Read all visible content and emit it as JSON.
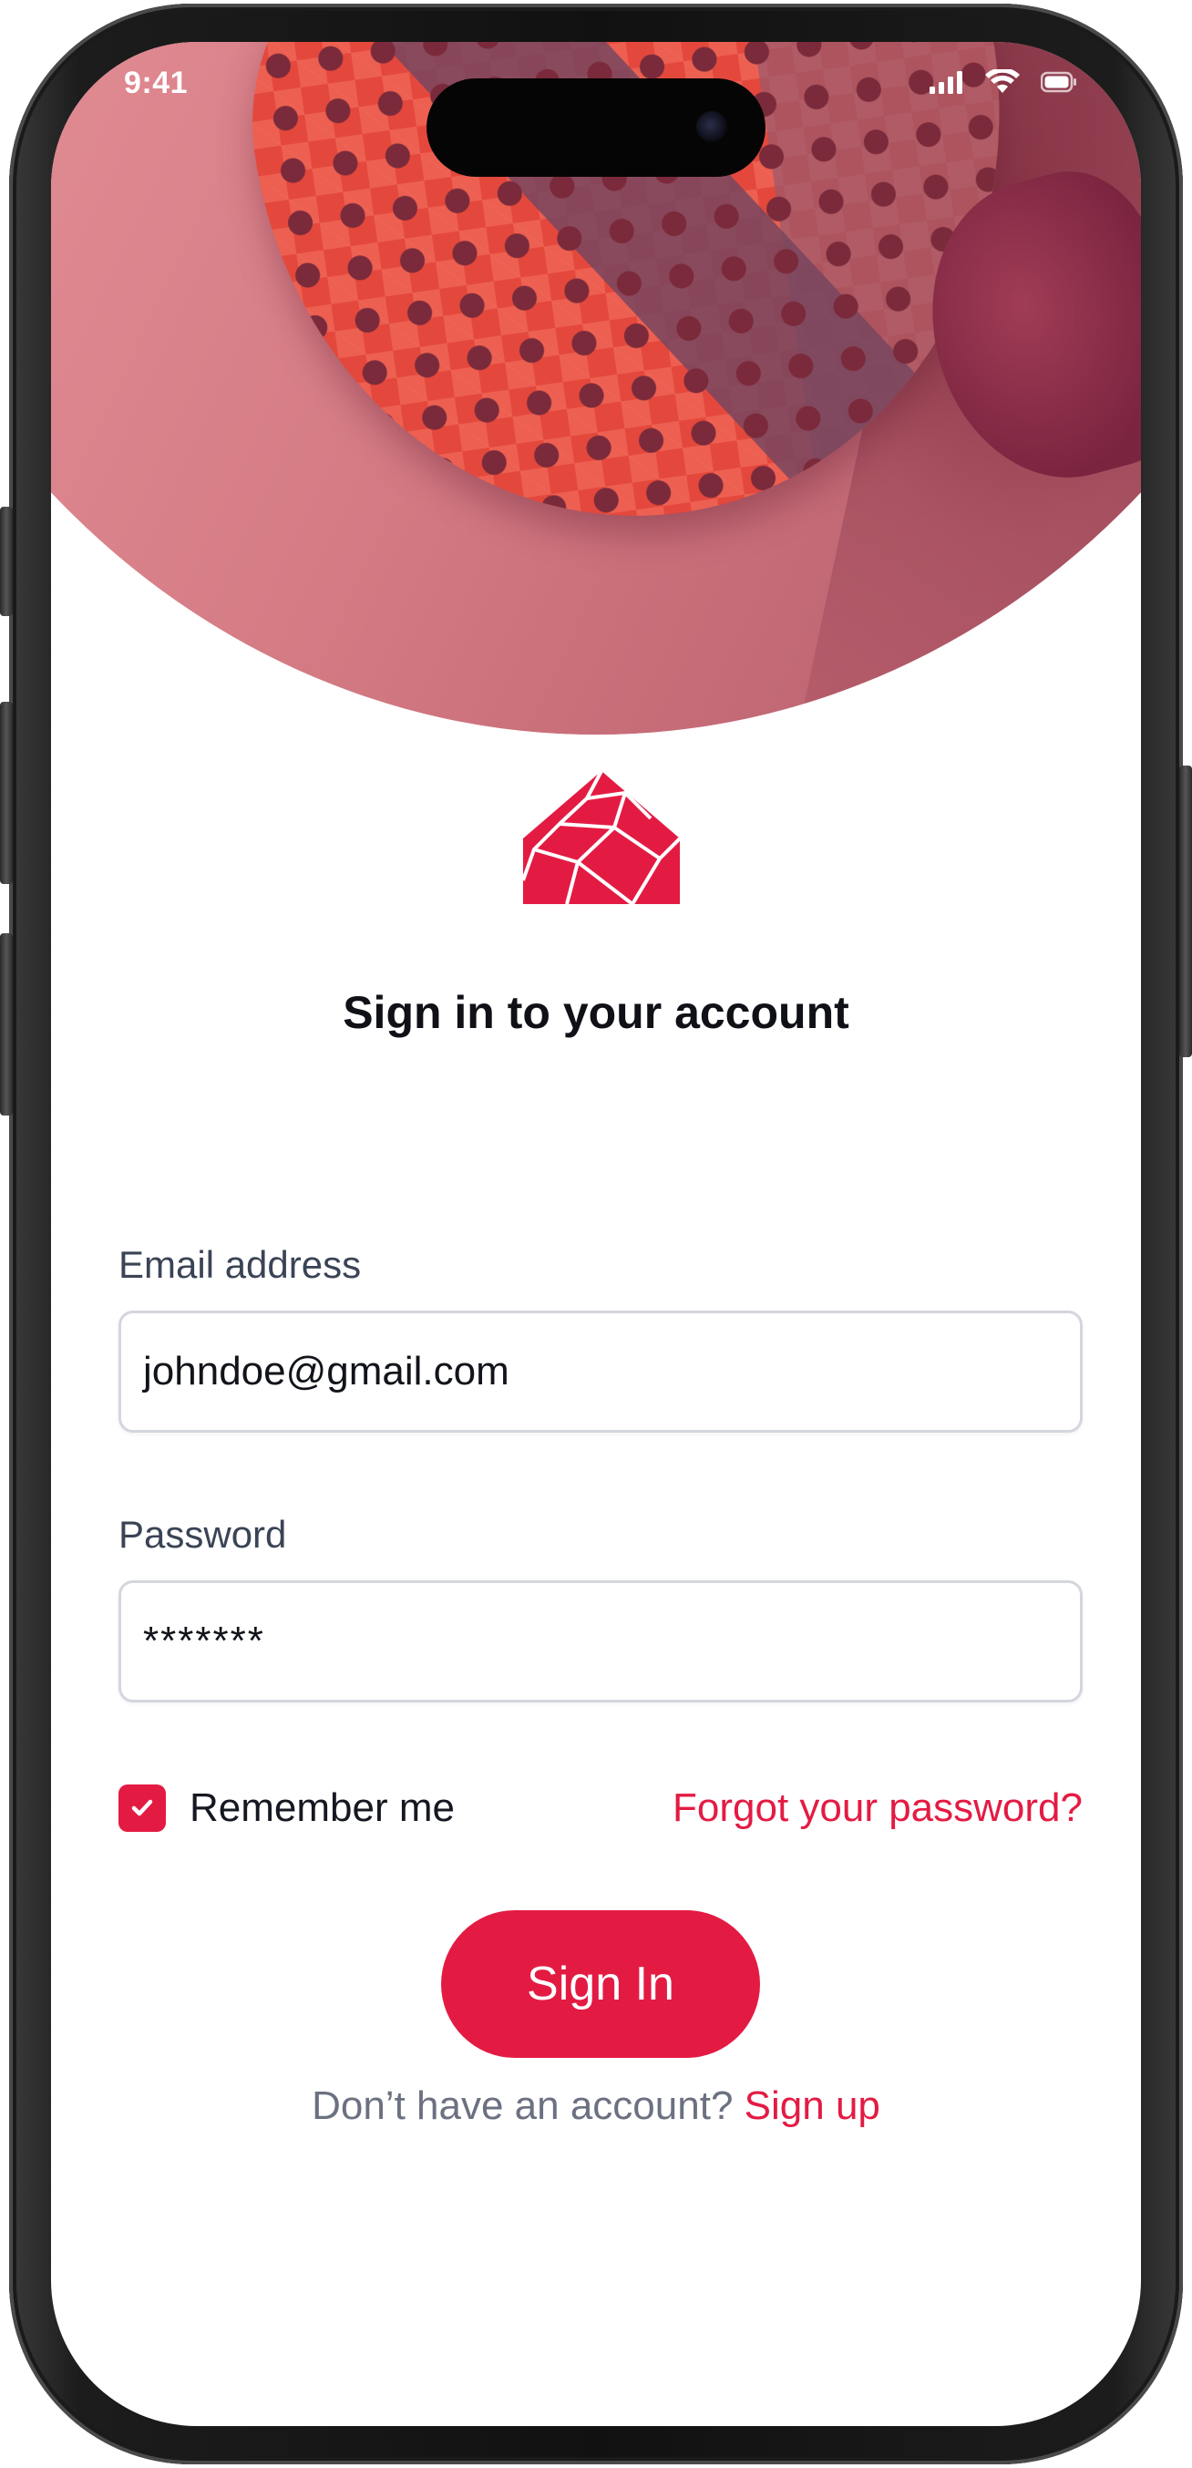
{
  "status_bar": {
    "time": "9:41",
    "icons": [
      "cellular-signal-icon",
      "wifi-icon",
      "battery-icon"
    ]
  },
  "hero": {
    "image": "padel-racket-photo"
  },
  "logo": {
    "icon": "faceted-house-logo"
  },
  "login": {
    "title": "Sign in to your account",
    "email_label": "Email address",
    "email_value": "johndoe@gmail.com",
    "password_label": "Password",
    "password_value": "*******",
    "remember_label": "Remember me",
    "remember_checked": true,
    "forgot_label": "Forgot your password?",
    "signin_label": "Sign In",
    "signup_prompt": "Don’t have an account?",
    "signup_label": "Sign up"
  },
  "colors": {
    "accent": "#e31b43",
    "text_primary": "#0f1117",
    "text_label": "#3b4456",
    "text_muted": "#6b7180",
    "input_border": "#d4d6dd"
  }
}
